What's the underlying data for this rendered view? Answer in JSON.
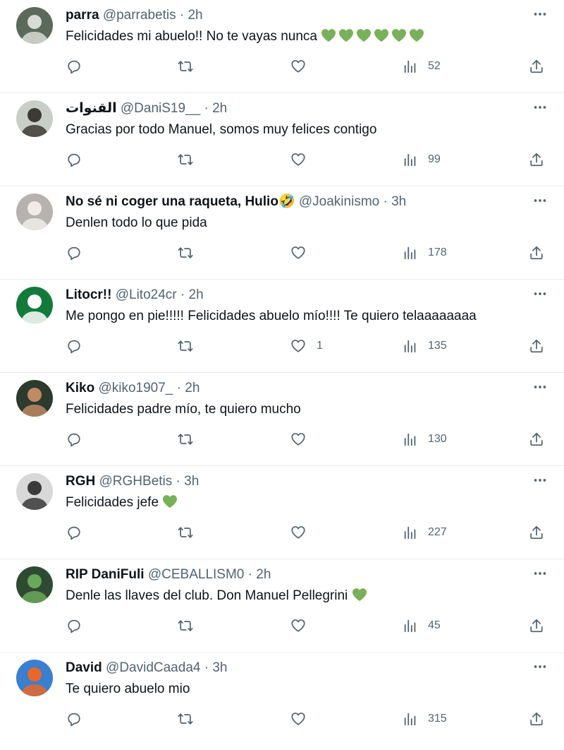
{
  "tweets": [
    {
      "name": "parra",
      "handle": "@parrabetis",
      "dot": "·",
      "time": "2h",
      "text": "Felicidades mi abuelo!! No te vayas nunca",
      "hearts": 6,
      "likes": "",
      "views": "52",
      "avatar": {
        "bg": "#5b6a5a",
        "fg": "#d8dcd6"
      }
    },
    {
      "name": "القنوات",
      "handle": "@DaniS19__",
      "dot": "·",
      "time": "2h",
      "text": "Gracias por todo Manuel, somos muy felices contigo",
      "hearts": 0,
      "likes": "",
      "views": "99",
      "avatar": {
        "bg": "#c9cfc7",
        "fg": "#3c3a34"
      }
    },
    {
      "name": "No sé ni coger una raqueta, Hulio🤣",
      "handle": "@Joakinismo",
      "dot": "·",
      "time": "3h",
      "text": "Denlen todo lo que pida",
      "hearts": 0,
      "likes": "",
      "views": "178",
      "avatar": {
        "bg": "#b7b2ae",
        "fg": "#f0ede8"
      }
    },
    {
      "name": "Litocr!!",
      "handle": "@Lito24cr",
      "dot": "·",
      "time": "2h",
      "text": "Me pongo en pie!!!!! Felicidades abuelo mío!!!! Te quiero telaaaaaaaa",
      "hearts": 0,
      "likes": "1",
      "views": "135",
      "avatar": {
        "bg": "#137a3c",
        "fg": "#ffffff"
      }
    },
    {
      "name": "Kiko",
      "handle": "@kiko1907_",
      "dot": "·",
      "time": "2h",
      "text": "Felicidades padre mío, te quiero mucho",
      "hearts": 0,
      "likes": "",
      "views": "130",
      "avatar": {
        "bg": "#2d3a2e",
        "fg": "#c08a63"
      }
    },
    {
      "name": "RGH",
      "handle": "@RGHBetis",
      "dot": "·",
      "time": "3h",
      "text": "Felicidades jefe",
      "hearts": 1,
      "likes": "",
      "views": "227",
      "avatar": {
        "bg": "#d8d8d8",
        "fg": "#3a3a3a"
      }
    },
    {
      "name": "RIP DaniFuli",
      "handle": "@CEBALLISM0",
      "dot": "·",
      "time": "2h",
      "text": "Denle las llaves del club. Don Manuel Pellegrini",
      "hearts": 1,
      "likes": "",
      "views": "45",
      "avatar": {
        "bg": "#2f4a33",
        "fg": "#6aa85a"
      }
    },
    {
      "name": "David",
      "handle": "@DavidCaada4",
      "dot": "·",
      "time": "3h",
      "text": "Te quiero abuelo mio",
      "hearts": 0,
      "likes": "",
      "views": "315",
      "avatar": {
        "bg": "#3a7fd0",
        "fg": "#e8682a"
      }
    }
  ],
  "colors": {
    "heart_emoji": "#78b159",
    "icon": "#536471",
    "divider": "#e6ecf0"
  },
  "icons": {
    "reply": "reply-icon",
    "retweet": "retweet-icon",
    "like": "like-icon",
    "views": "views-icon",
    "share": "share-icon",
    "more": "more-icon"
  }
}
